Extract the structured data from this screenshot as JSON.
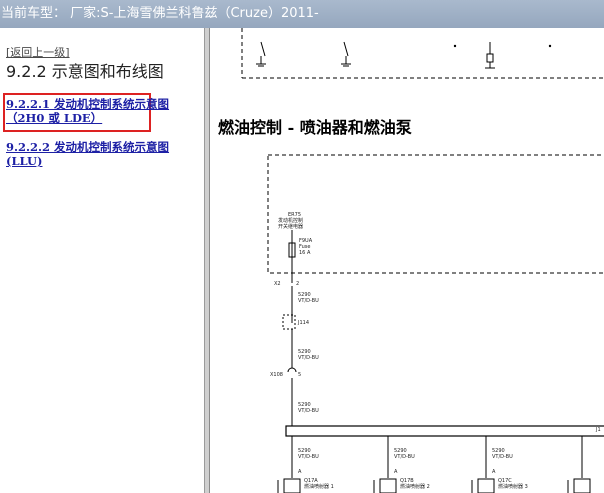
{
  "titlebar": {
    "text": "当前车型： 厂家:S-上海雪佛兰科鲁兹（Cruze）2011-"
  },
  "left_pane": {
    "back_link": "[返回上一级]",
    "section_title": "9.2.2 示意图和布线图",
    "links": [
      {
        "line1": "9.2.2.1 发动机控制系统示意图",
        "line2": "（2H0 或 LDE）"
      },
      {
        "line1": "9.2.2.2 发动机控制系统示意图",
        "line2": "(LLU)"
      }
    ]
  },
  "diagram": {
    "heading": "燃油控制 - 喷油器和燃油泵",
    "relay_label_1": "ER75",
    "relay_label_2": "发动机控制",
    "relay_label_3": "开关继电器",
    "fuse_name": "F9UA",
    "fuse_word": "Fuse",
    "fuse_rating": "16 A",
    "connector_x2": "X2",
    "pin_2": "2",
    "wire_label": "5290",
    "wire_color": "VT/D-BU",
    "splice": "J114",
    "connector_x108": "X108",
    "pin_5": "5",
    "junction_label": "J1",
    "injector_pin": "A",
    "injector_ids": [
      "Q17A",
      "Q17B",
      "Q17C"
    ],
    "injector_names": [
      "燃油喷射器 1",
      "燃油喷射器 2",
      "燃油喷射器 3"
    ]
  },
  "colors": {
    "link": "#1d20a5",
    "highlight": "#dd2222",
    "titlebar": "#9fb0c6"
  }
}
